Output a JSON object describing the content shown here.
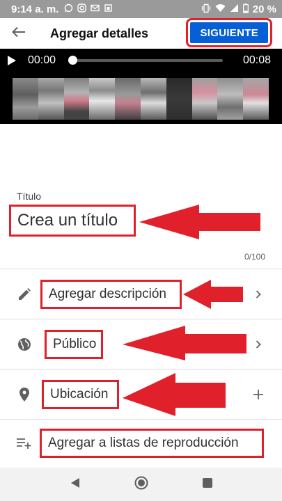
{
  "status_bar": {
    "time": "9:14 a. m.",
    "battery": "20 %",
    "icons": [
      "whatsapp-icon",
      "instagram-icon",
      "gmail-icon",
      "sim-icon",
      "vibrate-icon",
      "wifi-icon",
      "signal-icon",
      "battery-icon"
    ],
    "background_color": "#9a9a9a"
  },
  "app_bar": {
    "title": "Agregar detalles",
    "next_label": "SIGUIENTE",
    "accent_color": "#065fd4"
  },
  "video": {
    "time_current": "00:00",
    "time_total": "00:08",
    "progress": 0
  },
  "title_field": {
    "label": "Título",
    "placeholder": "Crea un título",
    "char_count": "0/100"
  },
  "rows": [
    {
      "label": "Agregar descripción",
      "icon": "pencil-icon",
      "trailing": "chevron-right-icon"
    },
    {
      "label": "Público",
      "icon": "globe-icon",
      "trailing": "chevron-right-icon"
    },
    {
      "label": "Ubicación",
      "icon": "location-pin-icon",
      "trailing": "plus-icon"
    },
    {
      "label": "Agregar a listas de reproducción",
      "icon": "playlist-add-icon",
      "trailing": ""
    }
  ],
  "annotation_color": "#e0202a"
}
